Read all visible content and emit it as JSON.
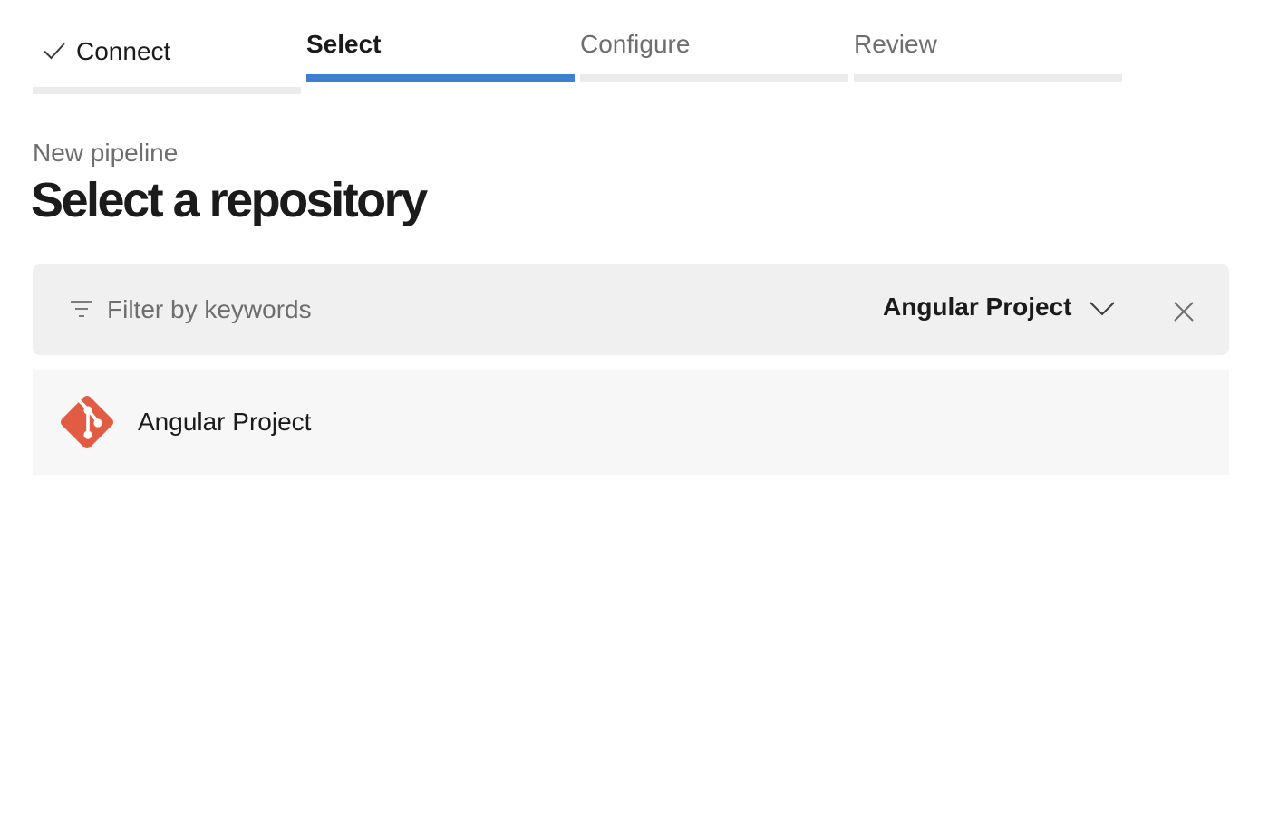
{
  "wizard": {
    "steps": [
      {
        "label": "Connect",
        "state": "completed",
        "icon": "check-icon"
      },
      {
        "label": "Select",
        "state": "active"
      },
      {
        "label": "Configure",
        "state": "pending"
      },
      {
        "label": "Review",
        "state": "pending"
      }
    ]
  },
  "header": {
    "subtitle": "New pipeline",
    "title": "Select a repository"
  },
  "filter": {
    "icon": "filter-icon",
    "placeholder": "Filter by keywords",
    "value": "",
    "project_dropdown": {
      "selected": "Angular Project",
      "icon": "chevron-down-icon"
    },
    "clear_icon": "close-icon"
  },
  "repositories": [
    {
      "name": "Angular Project",
      "icon": "git-icon"
    }
  ],
  "colors": {
    "accent": "#3f7fd1",
    "git_brand": "#e05d44",
    "filter_background": "#f0f0f0",
    "row_background": "#f7f7f7",
    "muted_text": "#6e6e6e"
  }
}
